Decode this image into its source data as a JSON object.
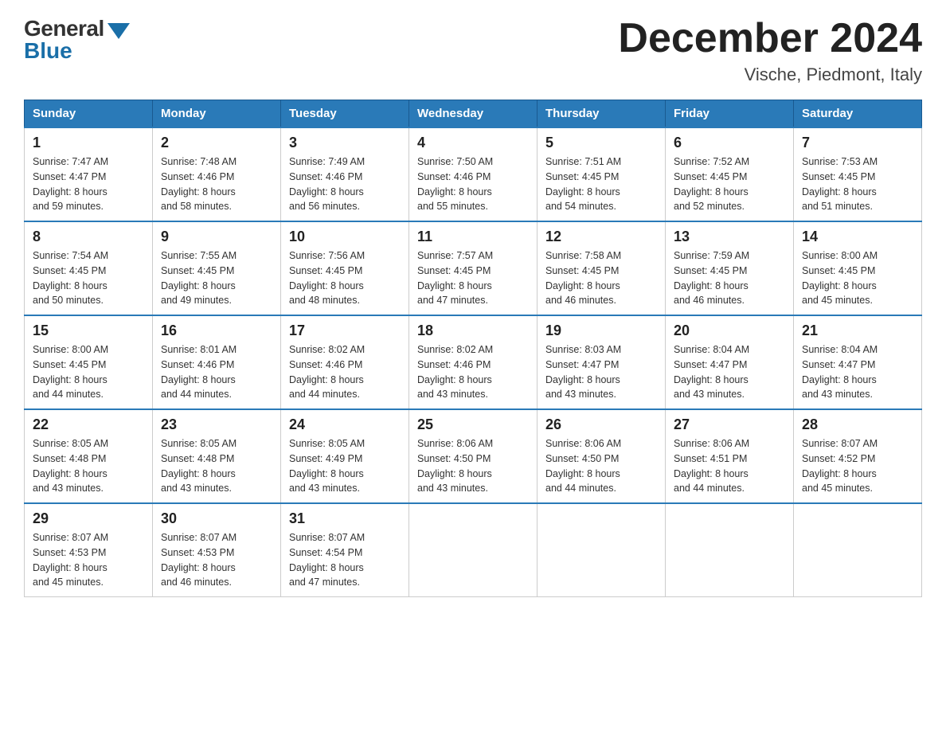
{
  "header": {
    "logo": {
      "general": "General",
      "blue": "Blue"
    },
    "title": "December 2024",
    "location": "Vische, Piedmont, Italy"
  },
  "days_of_week": [
    "Sunday",
    "Monday",
    "Tuesday",
    "Wednesday",
    "Thursday",
    "Friday",
    "Saturday"
  ],
  "weeks": [
    [
      {
        "day": "1",
        "sunrise": "7:47 AM",
        "sunset": "4:47 PM",
        "daylight": "8 hours and 59 minutes."
      },
      {
        "day": "2",
        "sunrise": "7:48 AM",
        "sunset": "4:46 PM",
        "daylight": "8 hours and 58 minutes."
      },
      {
        "day": "3",
        "sunrise": "7:49 AM",
        "sunset": "4:46 PM",
        "daylight": "8 hours and 56 minutes."
      },
      {
        "day": "4",
        "sunrise": "7:50 AM",
        "sunset": "4:46 PM",
        "daylight": "8 hours and 55 minutes."
      },
      {
        "day": "5",
        "sunrise": "7:51 AM",
        "sunset": "4:45 PM",
        "daylight": "8 hours and 54 minutes."
      },
      {
        "day": "6",
        "sunrise": "7:52 AM",
        "sunset": "4:45 PM",
        "daylight": "8 hours and 52 minutes."
      },
      {
        "day": "7",
        "sunrise": "7:53 AM",
        "sunset": "4:45 PM",
        "daylight": "8 hours and 51 minutes."
      }
    ],
    [
      {
        "day": "8",
        "sunrise": "7:54 AM",
        "sunset": "4:45 PM",
        "daylight": "8 hours and 50 minutes."
      },
      {
        "day": "9",
        "sunrise": "7:55 AM",
        "sunset": "4:45 PM",
        "daylight": "8 hours and 49 minutes."
      },
      {
        "day": "10",
        "sunrise": "7:56 AM",
        "sunset": "4:45 PM",
        "daylight": "8 hours and 48 minutes."
      },
      {
        "day": "11",
        "sunrise": "7:57 AM",
        "sunset": "4:45 PM",
        "daylight": "8 hours and 47 minutes."
      },
      {
        "day": "12",
        "sunrise": "7:58 AM",
        "sunset": "4:45 PM",
        "daylight": "8 hours and 46 minutes."
      },
      {
        "day": "13",
        "sunrise": "7:59 AM",
        "sunset": "4:45 PM",
        "daylight": "8 hours and 46 minutes."
      },
      {
        "day": "14",
        "sunrise": "8:00 AM",
        "sunset": "4:45 PM",
        "daylight": "8 hours and 45 minutes."
      }
    ],
    [
      {
        "day": "15",
        "sunrise": "8:00 AM",
        "sunset": "4:45 PM",
        "daylight": "8 hours and 44 minutes."
      },
      {
        "day": "16",
        "sunrise": "8:01 AM",
        "sunset": "4:46 PM",
        "daylight": "8 hours and 44 minutes."
      },
      {
        "day": "17",
        "sunrise": "8:02 AM",
        "sunset": "4:46 PM",
        "daylight": "8 hours and 44 minutes."
      },
      {
        "day": "18",
        "sunrise": "8:02 AM",
        "sunset": "4:46 PM",
        "daylight": "8 hours and 43 minutes."
      },
      {
        "day": "19",
        "sunrise": "8:03 AM",
        "sunset": "4:47 PM",
        "daylight": "8 hours and 43 minutes."
      },
      {
        "day": "20",
        "sunrise": "8:04 AM",
        "sunset": "4:47 PM",
        "daylight": "8 hours and 43 minutes."
      },
      {
        "day": "21",
        "sunrise": "8:04 AM",
        "sunset": "4:47 PM",
        "daylight": "8 hours and 43 minutes."
      }
    ],
    [
      {
        "day": "22",
        "sunrise": "8:05 AM",
        "sunset": "4:48 PM",
        "daylight": "8 hours and 43 minutes."
      },
      {
        "day": "23",
        "sunrise": "8:05 AM",
        "sunset": "4:48 PM",
        "daylight": "8 hours and 43 minutes."
      },
      {
        "day": "24",
        "sunrise": "8:05 AM",
        "sunset": "4:49 PM",
        "daylight": "8 hours and 43 minutes."
      },
      {
        "day": "25",
        "sunrise": "8:06 AM",
        "sunset": "4:50 PM",
        "daylight": "8 hours and 43 minutes."
      },
      {
        "day": "26",
        "sunrise": "8:06 AM",
        "sunset": "4:50 PM",
        "daylight": "8 hours and 44 minutes."
      },
      {
        "day": "27",
        "sunrise": "8:06 AM",
        "sunset": "4:51 PM",
        "daylight": "8 hours and 44 minutes."
      },
      {
        "day": "28",
        "sunrise": "8:07 AM",
        "sunset": "4:52 PM",
        "daylight": "8 hours and 45 minutes."
      }
    ],
    [
      {
        "day": "29",
        "sunrise": "8:07 AM",
        "sunset": "4:53 PM",
        "daylight": "8 hours and 45 minutes."
      },
      {
        "day": "30",
        "sunrise": "8:07 AM",
        "sunset": "4:53 PM",
        "daylight": "8 hours and 46 minutes."
      },
      {
        "day": "31",
        "sunrise": "8:07 AM",
        "sunset": "4:54 PM",
        "daylight": "8 hours and 47 minutes."
      },
      null,
      null,
      null,
      null
    ]
  ],
  "labels": {
    "sunrise_prefix": "Sunrise: ",
    "sunset_prefix": "Sunset: ",
    "daylight_prefix": "Daylight: "
  }
}
